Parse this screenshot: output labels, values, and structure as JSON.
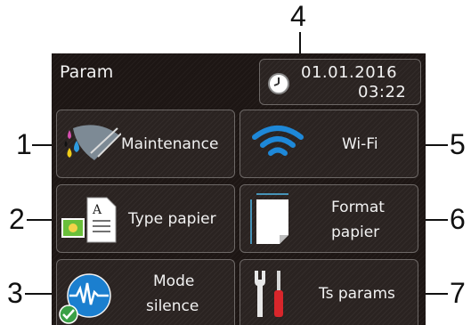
{
  "header": {
    "title": "Param",
    "date": "01.01.2016",
    "time": "03:22"
  },
  "buttons": {
    "maintenance": "Maintenance",
    "wifi": "Wi-Fi",
    "paper_type": "Type papier",
    "paper_format_line1": "Format",
    "paper_format_line2": "papier",
    "silent_line1": "Mode",
    "silent_line2": "silence",
    "all_settings": "Ts params"
  },
  "callouts": [
    "1",
    "2",
    "3",
    "4",
    "5",
    "6",
    "7"
  ],
  "icons": {
    "clock": "clock-icon",
    "maintenance": "ink-drops-icon",
    "wifi": "wifi-icon",
    "paper_type": "paper-type-icon",
    "paper_format": "paper-format-icon",
    "silent": "waveform-icon",
    "settings": "tools-icon"
  },
  "colors": {
    "screen_bg": "#1d1614",
    "button_bg": "#2a2321",
    "wifi_blue": "#1e88d8",
    "mode_blue": "#1b7fcf",
    "check_green": "#3aa046"
  }
}
